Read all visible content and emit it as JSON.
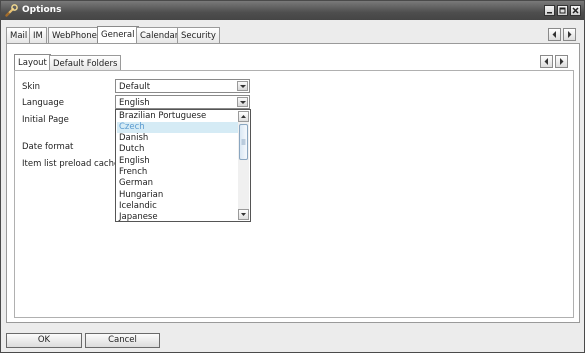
{
  "window": {
    "title": "Options"
  },
  "main_tabs": [
    "Mail",
    "IM",
    "WebPhone",
    "General",
    "Calendar",
    "Security"
  ],
  "main_tab_active": "General",
  "sub_tabs": [
    "Layout",
    "Default Folders"
  ],
  "sub_tab_active": "Layout",
  "form": {
    "skin_label": "Skin",
    "skin_value": "Default",
    "language_label": "Language",
    "language_value": "English",
    "initial_page_label": "Initial Page",
    "date_format_label": "Date format",
    "item_list_label": "Item list preload cache"
  },
  "language_options": [
    "Brazilian Portuguese",
    "Czech",
    "Danish",
    "Dutch",
    "English",
    "French",
    "German",
    "Hungarian",
    "Icelandic",
    "Japanese"
  ],
  "language_highlighted": "Czech",
  "buttons": {
    "ok": "OK",
    "cancel": "Cancel"
  },
  "icons": {
    "app": "wrench-icon",
    "minimize": "minimize-icon",
    "maximize": "maximize-icon",
    "close": "close-icon",
    "nav_prev": "chevron-left-icon",
    "nav_next": "chevron-right-icon",
    "dropdown": "chevron-down-icon",
    "scroll_up": "chevron-up-icon",
    "scroll_down": "chevron-down-icon"
  },
  "colors": {
    "titlebar": "#4e4e4e",
    "highlight_bg": "#d5ebf5",
    "highlight_text": "#5c9bd0"
  }
}
